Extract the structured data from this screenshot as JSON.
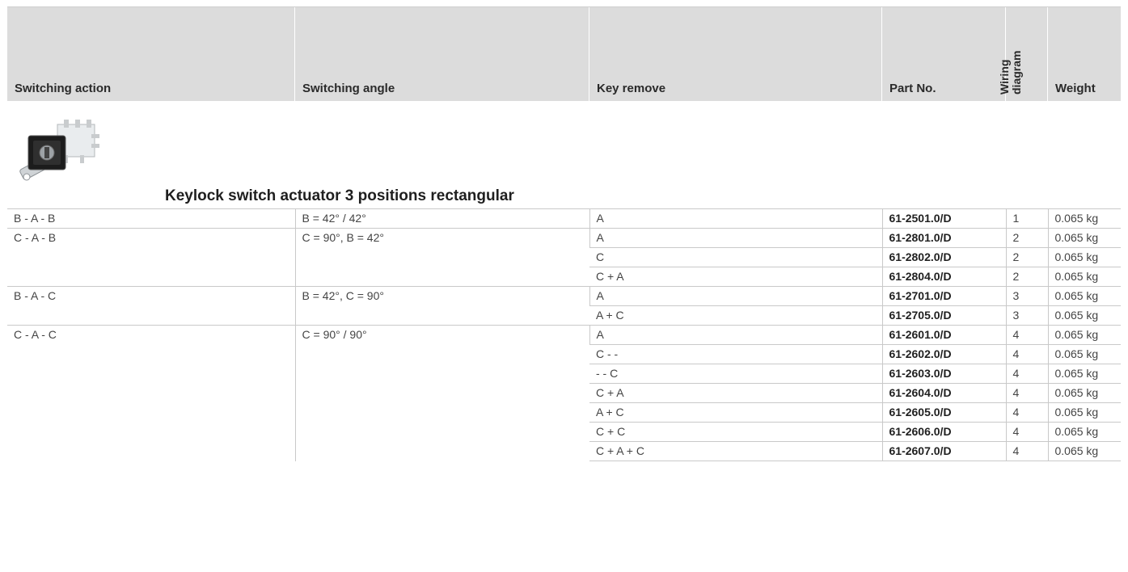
{
  "header": {
    "columns": [
      "Switching action",
      "Switching angle",
      "Key remove",
      "Part No.",
      "Wiring diagram",
      "Weight"
    ]
  },
  "section": {
    "title": "Keylock switch actuator 3 positions rectangular",
    "image": "keylock-switch-photo"
  },
  "rows": [
    {
      "action": "B - A - B",
      "angle": "B = 42° / 42°",
      "key": "A",
      "part": "61-2501.0/D",
      "wiring": "1",
      "weight": "0.065 kg"
    },
    {
      "action": "C - A - B",
      "angle": "C = 90°, B = 42°",
      "key": "A",
      "part": "61-2801.0/D",
      "wiring": "2",
      "weight": "0.065 kg"
    },
    {
      "action": "",
      "angle": "",
      "key": "C",
      "part": "61-2802.0/D",
      "wiring": "2",
      "weight": "0.065 kg"
    },
    {
      "action": "",
      "angle": "",
      "key": "C + A",
      "part": "61-2804.0/D",
      "wiring": "2",
      "weight": "0.065 kg"
    },
    {
      "action": "B - A - C",
      "angle": "B = 42°, C = 90°",
      "key": "A",
      "part": "61-2701.0/D",
      "wiring": "3",
      "weight": "0.065 kg"
    },
    {
      "action": "",
      "angle": "",
      "key": "A + C",
      "part": "61-2705.0/D",
      "wiring": "3",
      "weight": "0.065 kg"
    },
    {
      "action": "C - A - C",
      "angle": "C = 90° / 90°",
      "key": "A",
      "part": "61-2601.0/D",
      "wiring": "4",
      "weight": "0.065 kg"
    },
    {
      "action": "",
      "angle": "",
      "key": "C - -",
      "part": "61-2602.0/D",
      "wiring": "4",
      "weight": "0.065 kg"
    },
    {
      "action": "",
      "angle": "",
      "key": "- - C",
      "part": "61-2603.0/D",
      "wiring": "4",
      "weight": "0.065 kg"
    },
    {
      "action": "",
      "angle": "",
      "key": "C + A",
      "part": "61-2604.0/D",
      "wiring": "4",
      "weight": "0.065 kg"
    },
    {
      "action": "",
      "angle": "",
      "key": "A + C",
      "part": "61-2605.0/D",
      "wiring": "4",
      "weight": "0.065 kg"
    },
    {
      "action": "",
      "angle": "",
      "key": "C + C",
      "part": "61-2606.0/D",
      "wiring": "4",
      "weight": "0.065 kg"
    },
    {
      "action": "",
      "angle": "",
      "key": "C + A + C",
      "part": "61-2607.0/D",
      "wiring": "4",
      "weight": "0.065 kg"
    }
  ],
  "colors": {
    "header_bg": "#dcdcdc",
    "rule": "#c9c9c9"
  }
}
